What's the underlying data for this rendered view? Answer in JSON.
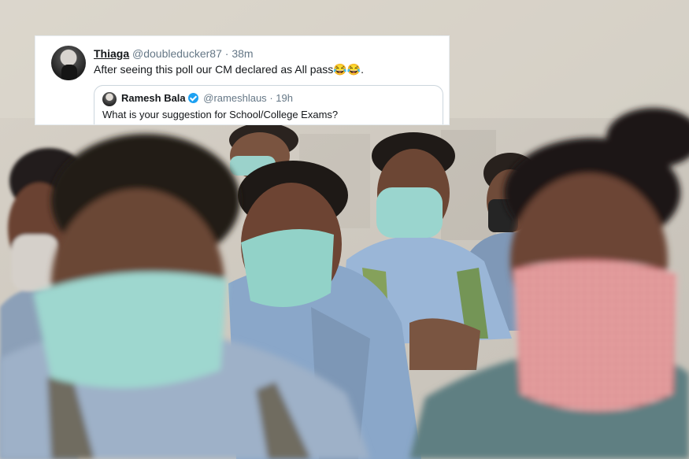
{
  "tweet": {
    "name": "Thiaga",
    "handle": "@doubleducker87",
    "separator": "·",
    "time": "38m",
    "text": "After seeing this poll our CM declared as All pass😂😂."
  },
  "quoted_tweet": {
    "name": "Ramesh Bala",
    "handle": "@rameshlaus",
    "separator": "·",
    "time": "19h",
    "text": "What is your suggestion for School/College Exams?"
  },
  "colors": {
    "verified_badge": "#1da1f2",
    "handle_gray": "#657786",
    "mask_checkered_red": "#d66b6b",
    "surgical_mask_teal": "#8fcfc4",
    "uniform_blue": "#8ea8c6"
  }
}
